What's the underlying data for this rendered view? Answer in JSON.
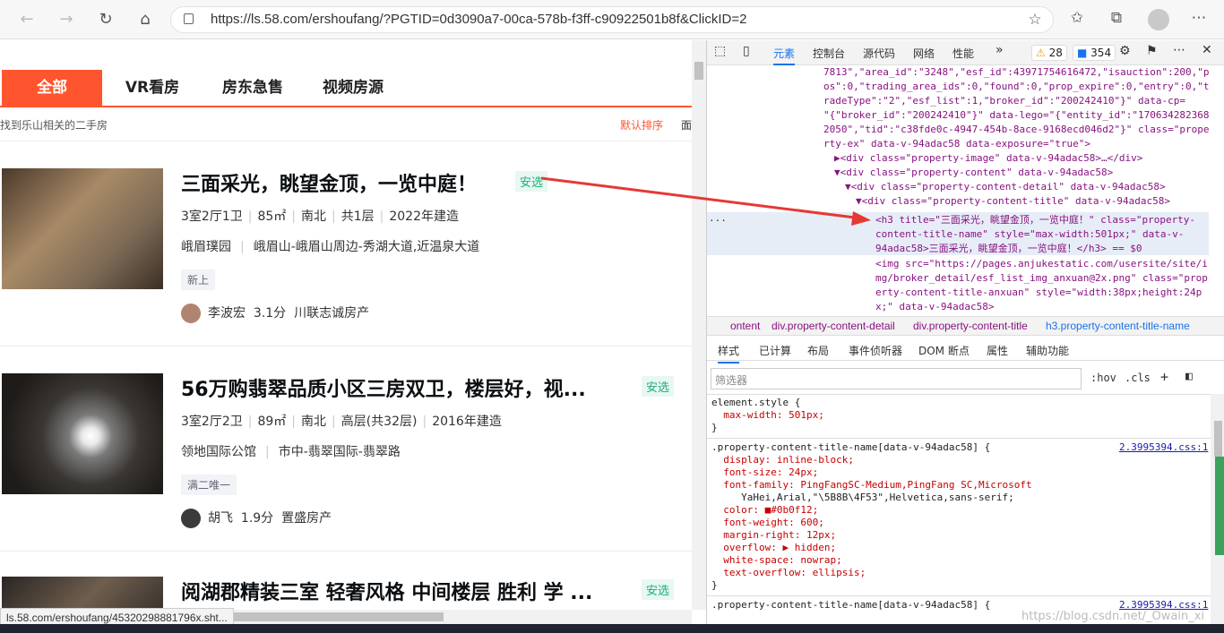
{
  "browser": {
    "url": "https://ls.58.com/ershoufang/?PGTID=0d3090a7-00ca-578b-f3ff-c90922501b8f&ClickID=2",
    "status_url": "ls.58.com/ershoufang/45320298881796x.sht..."
  },
  "page": {
    "tabs": [
      "全部",
      "VR看房",
      "房东急售",
      "视频房源"
    ],
    "result_info": "找到乐山相关的二手房",
    "sort_label": "默认排序",
    "sort_extra": "面",
    "listings": [
      {
        "title": "三面采光，眺望金顶，一览中庭！",
        "badge": "安选",
        "meta": [
          "3室2厅1卫",
          "85㎡",
          "南北",
          "共1层",
          "2022年建造"
        ],
        "community": "峨眉璞园",
        "location": "峨眉山-峨眉山周边-秀湖大道,近温泉大道",
        "tag": "新上",
        "broker_name": "李波宏",
        "broker_score": "3.1分",
        "broker_company": "川联志诚房产"
      },
      {
        "title": "56万购翡翠品质小区三房双卫，楼层好，视...",
        "badge": "安选",
        "meta": [
          "3室2厅2卫",
          "89㎡",
          "南北",
          "高层(共32层)",
          "2016年建造"
        ],
        "community": "领地国际公馆",
        "location": "市中-翡翠国际-翡翠路",
        "tag": "满二唯一",
        "broker_name": "胡飞",
        "broker_score": "1.9分",
        "broker_company": "置盛房产"
      },
      {
        "title": "阅湖郡精装三室 轻奢风格 中间楼层 胜利 学 ...",
        "badge": "安选"
      }
    ]
  },
  "devtools": {
    "tabs": [
      "元素",
      "控制台",
      "源代码",
      "网络",
      "性能"
    ],
    "warnings": "28",
    "messages": "354",
    "dom_lines": [
      "7813\",\"area_id\":\"3248\",\"esf_id\":43971754616472,\"isauction\":200,\"p",
      "os\":0,\"trading_area_ids\":0,\"found\":0,\"prop_expire\":0,\"entry\":0,\"t",
      "radeType\":\"2\",\"esf_list\":1,\"broker_id\":\"200242410\"}\" data-cp=",
      "\"{\"broker_id\":\"200242410\"}\" data-lego=\"{\"entity_id\":\"170634282368",
      "2050\",\"tid\":\"c38fde0c-4947-454b-8ace-9168ecd046d2\"}\" class=\"prope",
      "rty-ex\" data-v-94adac58 data-exposure=\"true\">",
      "▶<div class=\"property-image\" data-v-94adac58>…</div>",
      "▼<div class=\"property-content\" data-v-94adac58>",
      "▼<div class=\"property-content-detail\" data-v-94adac58>",
      "▼<div class=\"property-content-title\" data-v-94adac58>",
      "<h3 title=\"三面采光，眺望金顶，一览中庭！\" class=\"property-",
      "content-title-name\" style=\"max-width:501px;\" data-v-",
      "94adac58>三面采光，眺望金顶，一览中庭！</h3> == $0",
      "<img src=\"https://pages.anjukestatic.com/usersite/site/i",
      "mg/broker_detail/esf_list_img_anxuan@2x.png\" class=\"prop",
      "erty-content-title-anxuan\" style=\"width:38px;height:24p",
      "x;\" data-v-94adac58>"
    ],
    "dots": "···",
    "breadcrumbs": [
      "ontent",
      "div.property-content-detail",
      "div.property-content-title",
      "h3.property-content-title-name"
    ],
    "style_tabs": [
      "样式",
      "已计算",
      "布局",
      "事件侦听器",
      "DOM 断点",
      "属性",
      "辅助功能"
    ],
    "filter_placeholder": "筛选器",
    "hov": ":hov",
    "cls": ".cls",
    "css_lines": [
      "element.style {",
      "  max-width: 501px;",
      "}",
      ".property-content-title-name[data-v-94adac58] {",
      "  display: inline-block;",
      "  font-size: 24px;",
      "  font-family: PingFangSC-Medium,PingFang SC,Microsoft",
      "     YaHei,Arial,\"\\5B8B\\4F53\",Helvetica,sans-serif;",
      "  color: ■#0b0f12;",
      "  font-weight: 600;",
      "  margin-right: 12px;",
      "  overflow: ▶ hidden;",
      "  white-space: nowrap;",
      "  text-overflow: ellipsis;",
      "}",
      ".property-content-title-name[data-v-94adac58] {"
    ],
    "css_source": "2.3995394.css:1"
  },
  "watermark": "https://blog.csdn.net/_Owain_xi",
  "colors": {
    "accent": "#ff552e",
    "badge": "#1bae7c",
    "arrow": "#e53935",
    "devtools_link": "#1a73e8"
  }
}
